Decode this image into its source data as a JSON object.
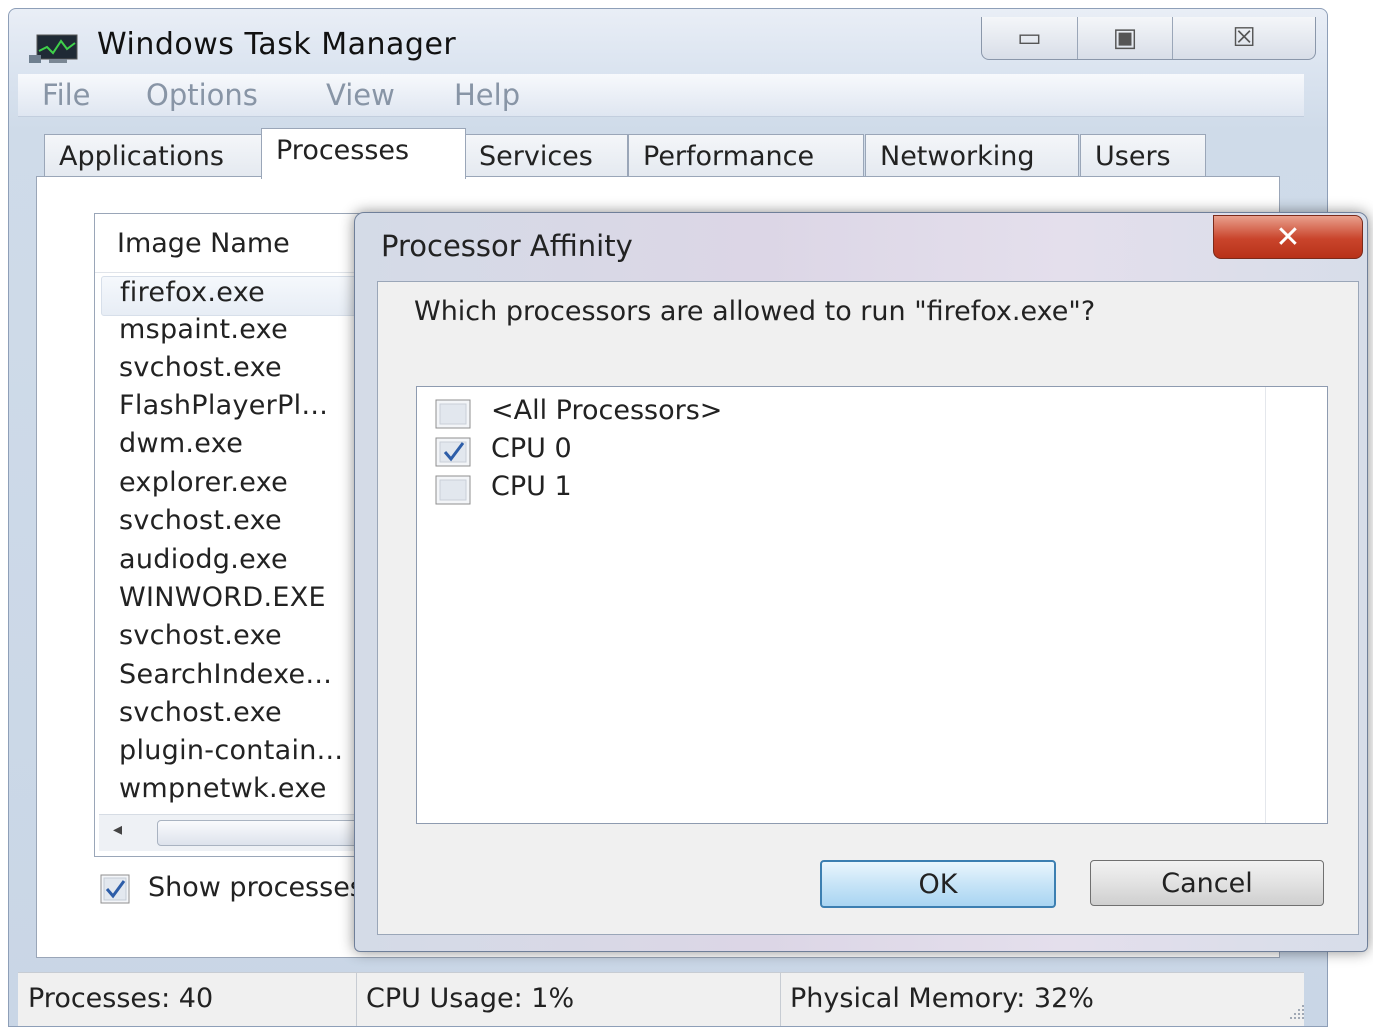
{
  "window": {
    "title": "Windows Task Manager",
    "caption_minimize": "▭",
    "caption_maximize": "▣",
    "caption_close": "☒"
  },
  "menu": [
    "File",
    "Options",
    "View",
    "Help"
  ],
  "tabs": [
    "Applications",
    "Processes",
    "Services",
    "Performance",
    "Networking",
    "Users"
  ],
  "active_tab": "Processes",
  "process_list": {
    "column_header": "Image Name",
    "rows": [
      "firefox.exe",
      "mspaint.exe",
      "svchost.exe",
      "FlashPlayerPl...",
      "dwm.exe",
      "explorer.exe",
      "svchost.exe",
      "audiodg.exe",
      "WINWORD.EXE",
      "svchost.exe",
      "SearchIndexe...",
      "svchost.exe",
      "plugin-contain...",
      "wmpnetwk.exe"
    ],
    "selected_index": 0,
    "scroll_left_arrow": "◂"
  },
  "show_processes": {
    "label": "Show processes from all users",
    "checked": true
  },
  "status": {
    "processes": "Processes: 40",
    "cpu_usage": "CPU Usage: 1%",
    "physical_memory": "Physical Memory: 32%"
  },
  "dialog": {
    "title": "Processor Affinity",
    "close_glyph": "✕",
    "question": "Which processors are allowed to run \"firefox.exe\"?",
    "options": [
      {
        "label": "<All Processors>",
        "checked": false
      },
      {
        "label": "CPU 0",
        "checked": true
      },
      {
        "label": "CPU 1",
        "checked": false
      }
    ],
    "ok_label": "OK",
    "cancel_label": "Cancel"
  },
  "colors": {
    "ok_border": "#3c7fb1",
    "close_red": "#c9442b",
    "check_blue": "#2d5da8"
  }
}
